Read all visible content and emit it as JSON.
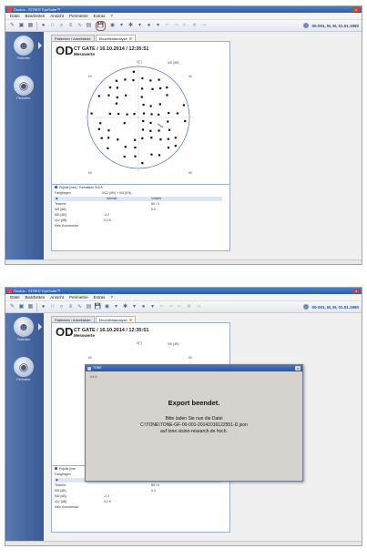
{
  "app": {
    "title": "Oculus - STREIT EyeSuite™"
  },
  "menu": {
    "items": [
      "Datei",
      "Bearbeiten",
      "Ansicht",
      "Perimetrie",
      "Extras",
      "?"
    ]
  },
  "patient": {
    "label": "00-001, M, M, 01.01.1980"
  },
  "nav": {
    "patienten": "Patienten",
    "perimeter": "Perimeter"
  },
  "tabs": [
    {
      "label": "Patienten / Arbeitsliste"
    },
    {
      "label": "Einzelfeldanalyse"
    }
  ],
  "exam": {
    "eye": "OD",
    "header": "CT GATE / 16.10.2014 / 12:35:51",
    "subtitle": "Messwerte"
  },
  "field": {
    "top": "S[°]",
    "unit": "MS [dB]",
    "tl": "60",
    "tr": "60",
    "bl": "60",
    "br": "60"
  },
  "summary": {
    "pupil": "Pupille [mm] / Refraktion S/Z/A",
    "fix_label": "Fangfragen",
    "fix_value": "0/12 (0%) + 0/0 (0%) -",
    "col_normal": "Normal",
    "col_indices": "Indizes",
    "rows": [
      {
        "label": "Testorte",
        "normal": "",
        "indices": "80 / 0"
      },
      {
        "label": "MS [dB]",
        "normal": "",
        "indices": "0.0"
      },
      {
        "label": "MD [dB]",
        "normal": "-2.2",
        "indices": ""
      },
      {
        "label": "sLV [dB]",
        "normal": "0.2.5",
        "indices": ""
      }
    ],
    "comment": "Kein Kommentar"
  },
  "dialog": {
    "title": "TONE",
    "version": "v1.0",
    "heading": "Export beendet.",
    "line1": "Bitte laden Sie nun die Datei",
    "line2": "C:\\TONE\\TONE-GF-00-001-20141016122551-D.json",
    "line3": "auf tone.vision-research.de hoch."
  },
  "truncated": {
    "pupil": "Pupille [mm"
  }
}
